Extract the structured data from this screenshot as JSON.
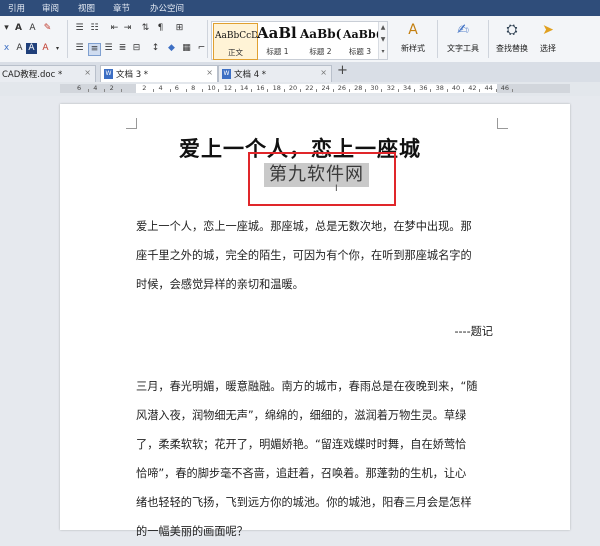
{
  "menu": {
    "items": [
      "引用",
      "审阅",
      "视图",
      "章节",
      "办公空间"
    ]
  },
  "ribbon": {
    "styles": [
      {
        "sample": "AaBbCcDd",
        "name": "正文"
      },
      {
        "sample": "AaBl",
        "name": "标题 1"
      },
      {
        "sample": "AaBb(",
        "name": "标题 2"
      },
      {
        "sample": "AaBb(",
        "name": "标题 3"
      }
    ],
    "buttons": {
      "new_style": "新样式",
      "text_tools": "文字工具",
      "find_replace": "查找替换",
      "select": "选择"
    }
  },
  "tabs": [
    {
      "label": "CAD教程.doc *",
      "active": false
    },
    {
      "label": "文档 3 *",
      "active": true
    },
    {
      "label": "文档 4 *",
      "active": false
    }
  ],
  "ruler": {
    "numbers": [
      "6",
      "4",
      "2",
      "2",
      "4",
      "6",
      "8",
      "10",
      "12",
      "14",
      "16",
      "18",
      "20",
      "22",
      "24",
      "26",
      "28",
      "30",
      "32",
      "34",
      "36",
      "38",
      "40",
      "42",
      "44",
      "46"
    ]
  },
  "document": {
    "title": "爱上一个人，恋上一座城",
    "subtitle": "第九软件网",
    "para1": [
      "爱上一个人，恋上一座城。那座城，总是无数次地，在梦中出现。那",
      "座千里之外的城，完全的陌生，可因为有个你，在听到那座城名字的",
      "时候，会感觉异样的亲切和温暖。"
    ],
    "signature": "----题记",
    "para2": [
      "三月，春光明媚，暖意融融。南方的城市，春雨总是在夜晚到来，“随",
      "风潜入夜，润物细无声”，绵绵的，细细的，滋润着万物生灵。草绿",
      "了，柔柔软软；花开了，明媚娇艳。“留连戏蝶时时舞，自在娇莺恰",
      "恰啼”，春的脚步毫不吝啬，追赶着，召唤着。那蓬勃的生机，让心",
      "绪也轻轻的飞扬，飞到远方你的城池。你的城池，阳春三月会是怎样",
      "的一幅美丽的画面呢？"
    ]
  },
  "colors": {
    "menubar": "#2f4d7a",
    "highlight": "#c9c9c9",
    "annotation_box": "#e0262a"
  }
}
